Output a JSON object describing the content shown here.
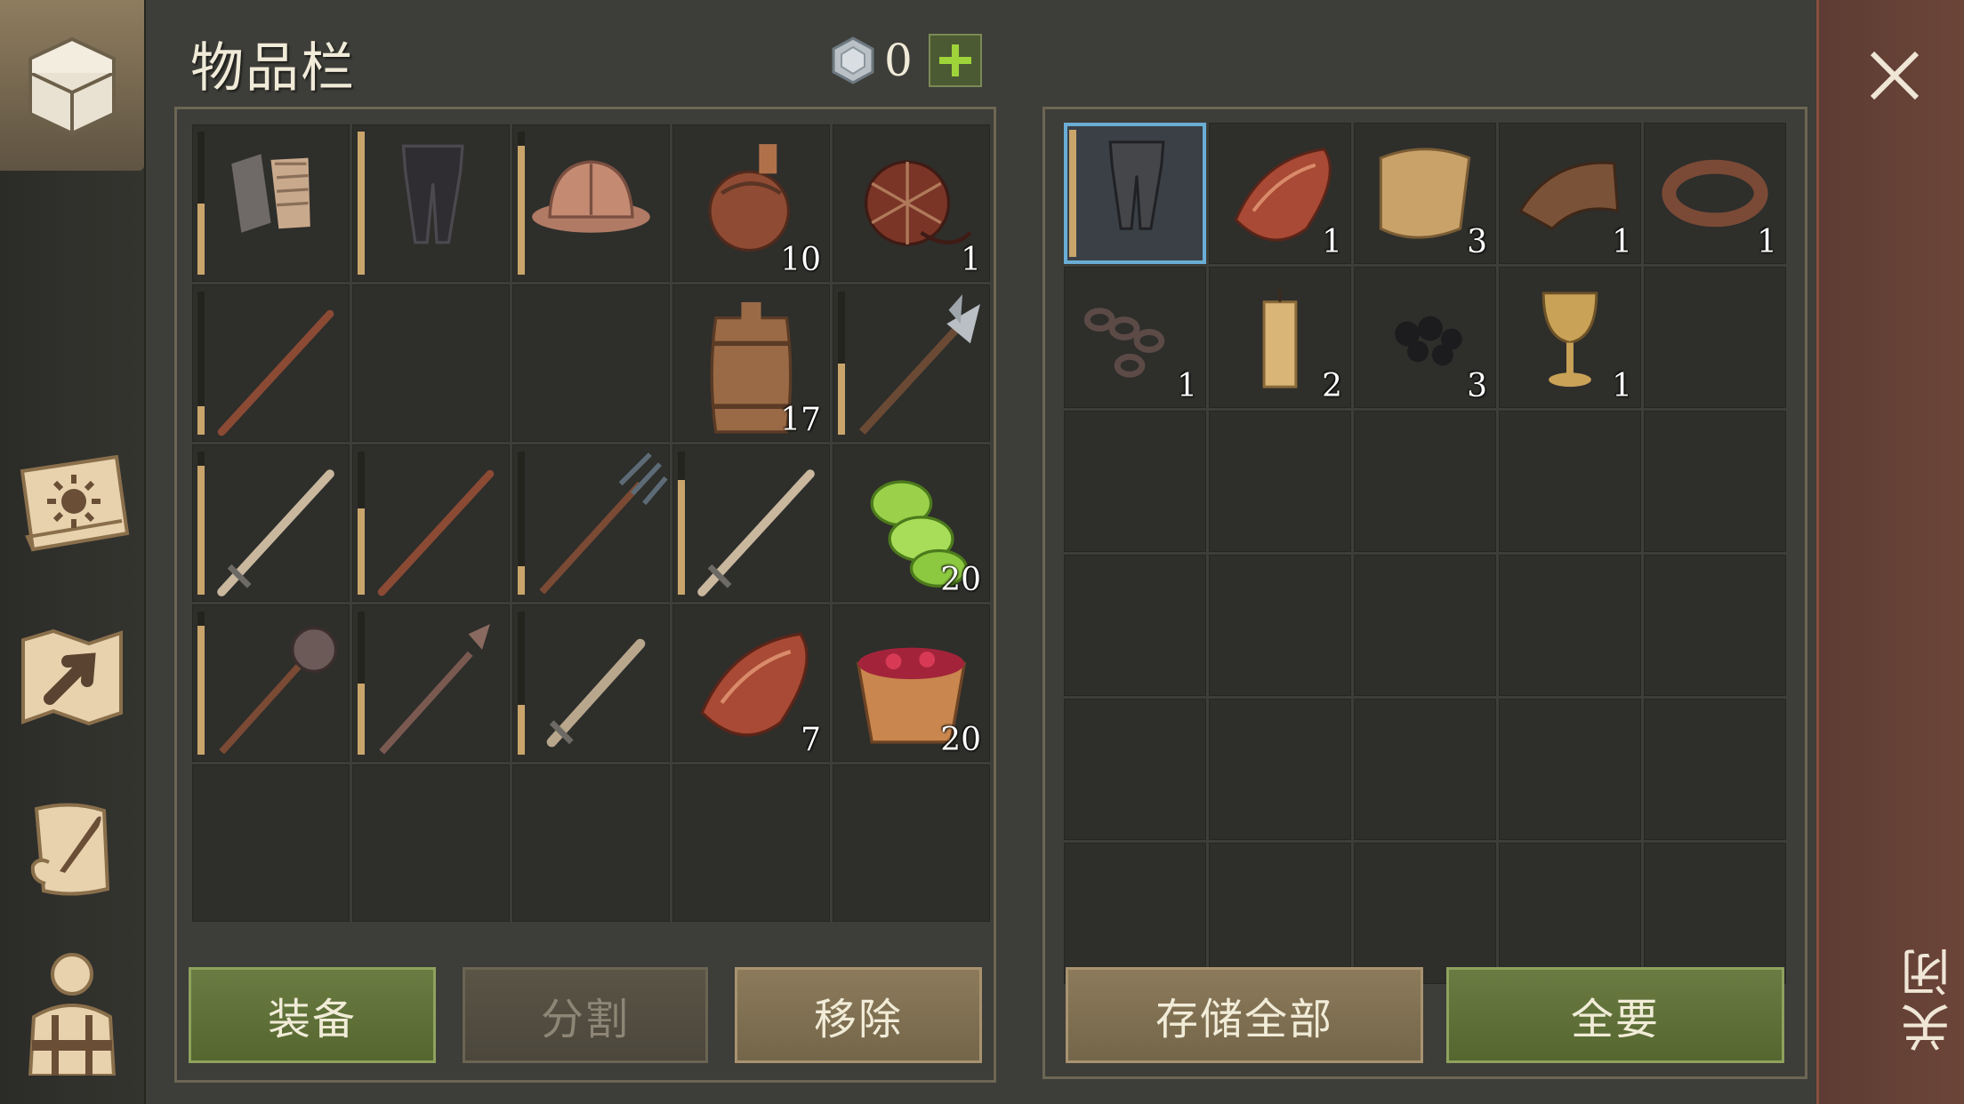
{
  "header": {
    "title": "物品栏",
    "currency_value": "0"
  },
  "sidebar": {
    "items": [
      {
        "name": "inventory-chest-icon",
        "active": true
      },
      {
        "name": "sun-book-icon"
      },
      {
        "name": "map-icon"
      },
      {
        "name": "scroll-quill-icon"
      },
      {
        "name": "character-icon"
      }
    ]
  },
  "inventory": {
    "rows": [
      [
        {
          "icon": "gloves-icon",
          "durability": 0.5
        },
        {
          "icon": "pants-icon",
          "durability": 1.0
        },
        {
          "icon": "helmet-icon",
          "durability": 0.9
        },
        {
          "icon": "flask-icon",
          "qty": "10"
        },
        {
          "icon": "waterskin-icon",
          "qty": "1"
        }
      ],
      [
        {
          "icon": "stick-icon",
          "durability": 0.2
        },
        {},
        {},
        {
          "icon": "barrel-icon",
          "qty": "17"
        },
        {
          "icon": "halberd-icon",
          "durability": 0.5
        }
      ],
      [
        {
          "icon": "sword-icon",
          "durability": 0.9
        },
        {
          "icon": "staff-icon",
          "durability": 0.6
        },
        {
          "icon": "pitchfork-icon",
          "durability": 0.2
        },
        {
          "icon": "sword-icon",
          "durability": 0.8
        },
        {
          "icon": "cucumber-icon",
          "qty": "20"
        }
      ],
      [
        {
          "icon": "mace-icon",
          "durability": 0.9
        },
        {
          "icon": "spear-mace-icon",
          "durability": 0.5
        },
        {
          "icon": "short-sword-icon",
          "durability": 0.35
        },
        {
          "icon": "meat-icon",
          "qty": "7"
        },
        {
          "icon": "berry-bowl-icon",
          "qty": "20"
        }
      ],
      [
        {},
        {},
        {},
        {},
        {}
      ]
    ]
  },
  "storage": {
    "rows": [
      [
        {
          "icon": "chainmail-pants-icon",
          "selected": true,
          "durability": 1.0
        },
        {
          "icon": "meat-icon",
          "qty": "1"
        },
        {
          "icon": "cloth-icon",
          "qty": "3"
        },
        {
          "icon": "leather-icon",
          "qty": "1"
        },
        {
          "icon": "leather-strip-icon",
          "qty": "1"
        }
      ],
      [
        {
          "icon": "chain-icon",
          "qty": "1"
        },
        {
          "icon": "candle-icon",
          "qty": "2"
        },
        {
          "icon": "coal-icon",
          "qty": "3"
        },
        {
          "icon": "goblet-icon",
          "qty": "1"
        },
        {}
      ],
      [
        {},
        {},
        {},
        {},
        {}
      ],
      [
        {},
        {},
        {},
        {},
        {}
      ],
      [
        {},
        {},
        {},
        {},
        {}
      ],
      [
        {},
        {},
        {},
        {},
        {}
      ]
    ]
  },
  "buttons": {
    "equip": "装备",
    "split": "分割",
    "remove": "移除",
    "store_all": "存储全部",
    "take_all": "全要"
  },
  "close": {
    "label": "关闭"
  },
  "colors": {
    "green": "#6a7c42",
    "tan": "#8c7a5a",
    "selected": "#6aaed6",
    "durability": "#c9a56c"
  }
}
